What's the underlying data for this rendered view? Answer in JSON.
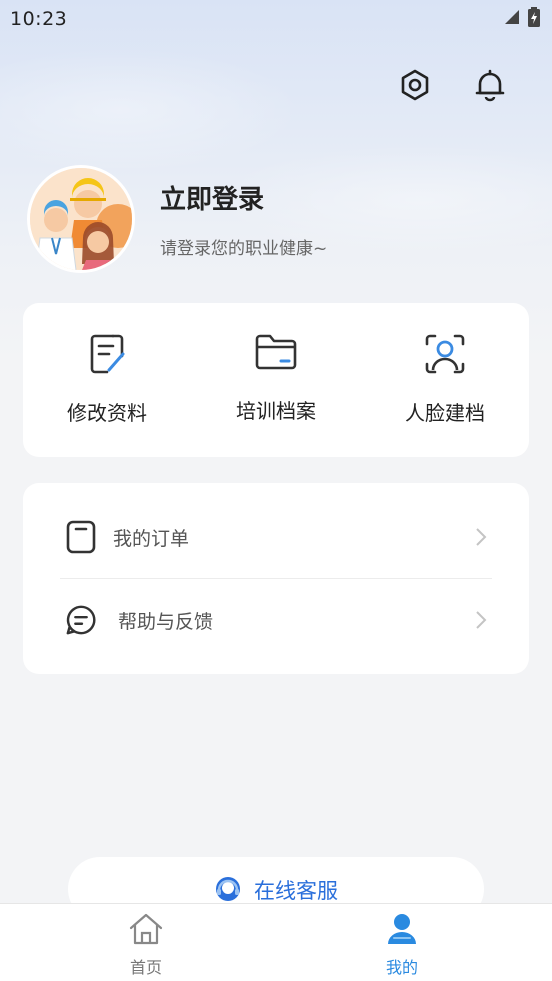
{
  "status_bar": {
    "time": "10:23"
  },
  "profile": {
    "login_title": "立即登录",
    "login_subtitle": "请登录您的职业健康~"
  },
  "quick_actions": [
    {
      "label": "修改资料",
      "icon": "edit-document-icon"
    },
    {
      "label": "培训档案",
      "icon": "folder-icon"
    },
    {
      "label": "人脸建档",
      "icon": "face-scan-icon"
    }
  ],
  "menu": [
    {
      "label": "我的订单",
      "icon": "order-icon"
    },
    {
      "label": "帮助与反馈",
      "icon": "feedback-icon"
    }
  ],
  "service": {
    "label": "在线客服",
    "icon": "headset-icon"
  },
  "tabs": [
    {
      "label": "首页",
      "icon": "home-icon",
      "active": false
    },
    {
      "label": "我的",
      "icon": "user-icon",
      "active": true
    }
  ],
  "colors": {
    "accent": "#2a8ae0",
    "service": "#2a6fdb",
    "background": "#f3f4f6"
  }
}
